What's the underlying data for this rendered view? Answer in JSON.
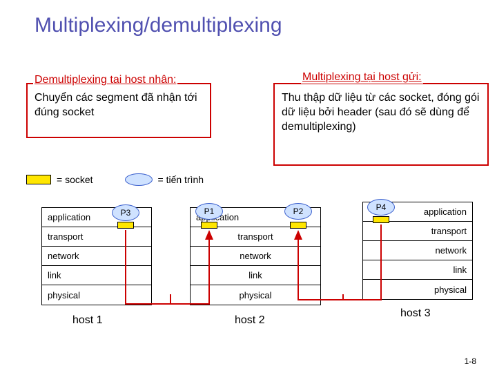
{
  "title": "Multiplexing/demultiplexing",
  "demux": {
    "heading": "Demultiplexing tai host nhân:",
    "body": "Chuyển các segment đã nhận tới đúng socket"
  },
  "mux": {
    "heading": "Multiplexing tại host gửi:",
    "body": "Thu thập dữ liệu từ các socket, đóng gói dữ liệu bởi header (sau đó sẽ dùng để demultiplexing)"
  },
  "legend": {
    "socket": "= socket",
    "process": "= tiến trình"
  },
  "layers": {
    "application": "application",
    "transport": "transport",
    "network": "network",
    "link": "link",
    "physical": "physical"
  },
  "hosts": {
    "h1": "host 1",
    "h2": "host 2",
    "h3": "host 3"
  },
  "procs": {
    "p1": "P1",
    "p2": "P2",
    "p3": "P3",
    "p4": "P4"
  },
  "page": "1-8"
}
